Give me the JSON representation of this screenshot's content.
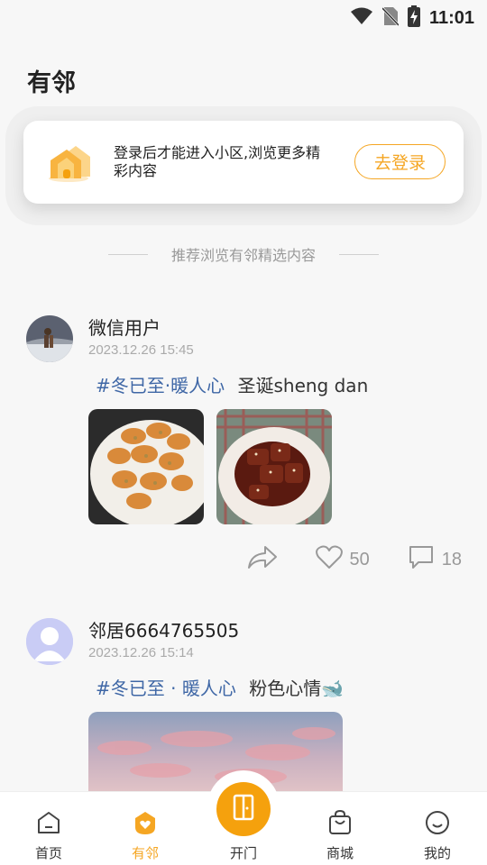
{
  "status_bar": {
    "time": "11:01",
    "icons": [
      "wifi-icon",
      "no-sim-icon",
      "battery-charging-icon"
    ]
  },
  "header": {
    "title": "有邻"
  },
  "login_card": {
    "message": "登录后才能进入小区,浏览更多精彩内容",
    "button_label": "去登录",
    "icon": "house-icon"
  },
  "divider": {
    "text": "推荐浏览有邻精选内容"
  },
  "posts": [
    {
      "username": "微信用户",
      "time": "2023.12.26 15:45",
      "hashtag": "#冬已至·暖人心",
      "text": "圣诞sheng dan",
      "photos": [
        "shrimp-photo",
        "braised-pork-photo"
      ],
      "likes": "50",
      "comments": "18"
    },
    {
      "username": "邻居6664765505",
      "time": "2023.12.26 15:14",
      "hashtag": "#冬已至 · 暖人心",
      "text": "粉色心情🐋",
      "photos": [
        "sunset-sky-photo"
      ]
    }
  ],
  "bottom_nav": {
    "items": [
      {
        "label": "首页",
        "icon": "home-icon"
      },
      {
        "label": "有邻",
        "icon": "neighbor-heart-icon"
      },
      {
        "label": "开门",
        "icon": "door-icon"
      },
      {
        "label": "商城",
        "icon": "shopping-bag-icon"
      },
      {
        "label": "我的",
        "icon": "smiley-icon"
      }
    ],
    "active": "有邻"
  },
  "colors": {
    "accent": "#f5a623",
    "hashtag": "#3f67a6",
    "background": "#f7f7f7"
  }
}
